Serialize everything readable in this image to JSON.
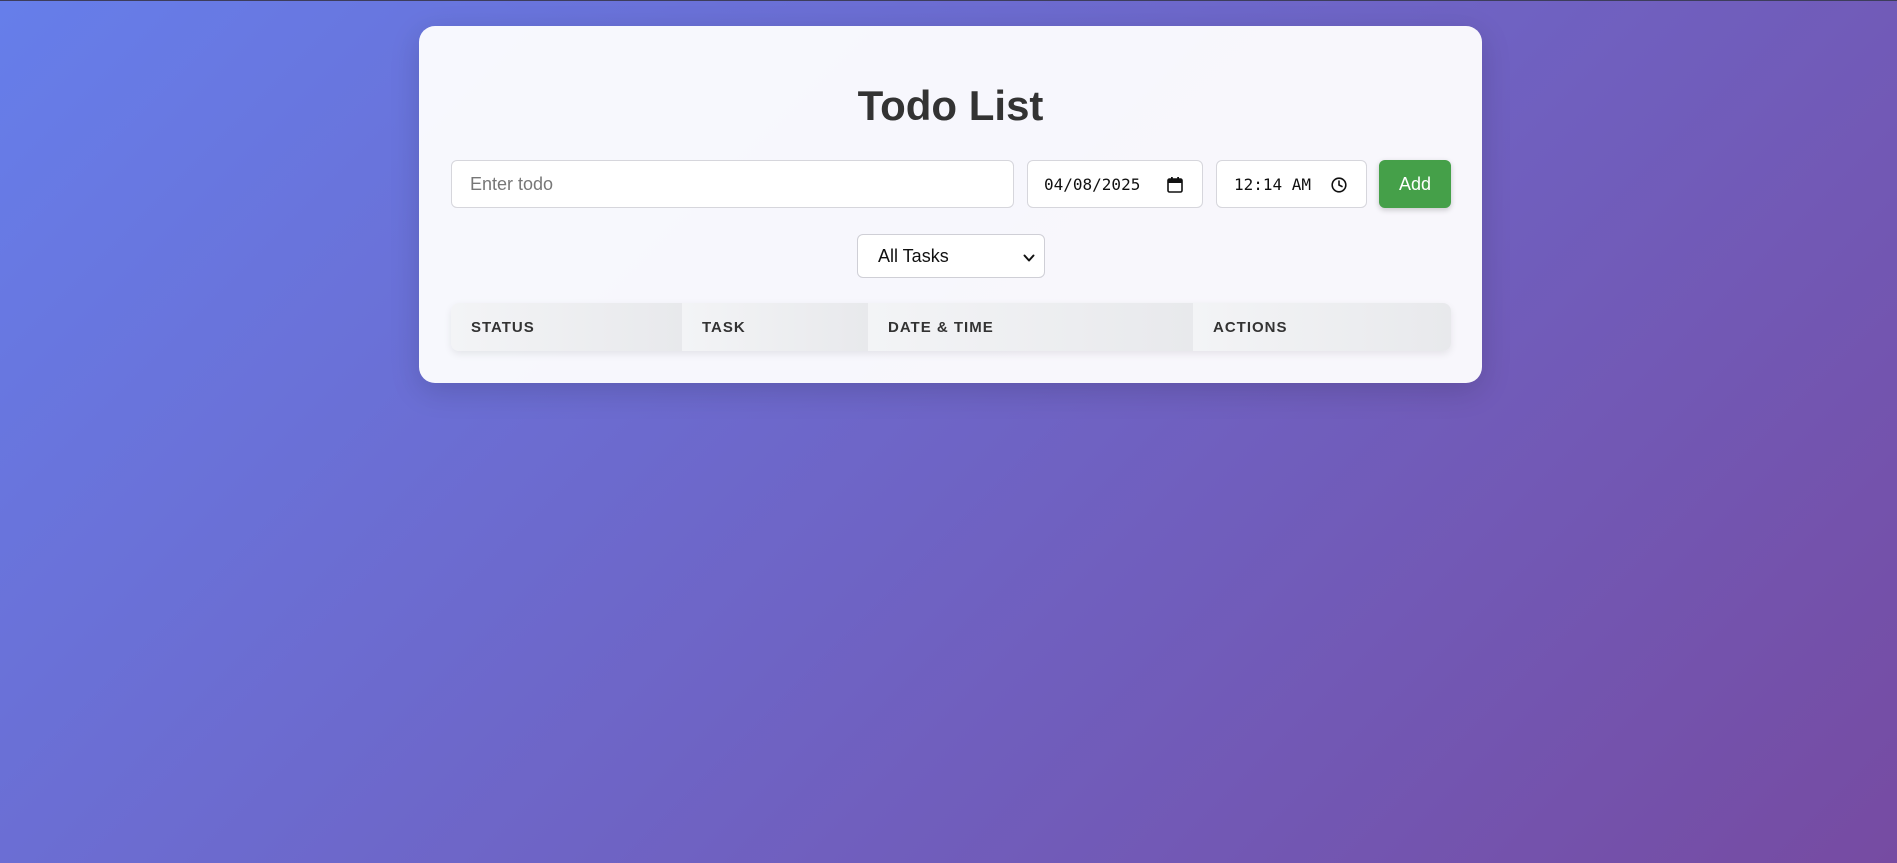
{
  "app": {
    "title": "Todo List"
  },
  "form": {
    "todo_placeholder": "Enter todo",
    "todo_value": "",
    "date_value": "04/08/2025",
    "time_value": "12:14 AM",
    "add_label": "Add"
  },
  "filter": {
    "selected": "All Tasks"
  },
  "table": {
    "columns": [
      "STATUS",
      "TASK",
      "DATE & TIME",
      "ACTIONS"
    ],
    "rows": []
  },
  "colors": {
    "background_start": "#667eea",
    "background_end": "#764ba2",
    "add_button": "#45a049",
    "title": "#333333"
  },
  "icons": {
    "date": "calendar-icon",
    "time": "clock-icon",
    "filter": "chevron-down-icon"
  }
}
